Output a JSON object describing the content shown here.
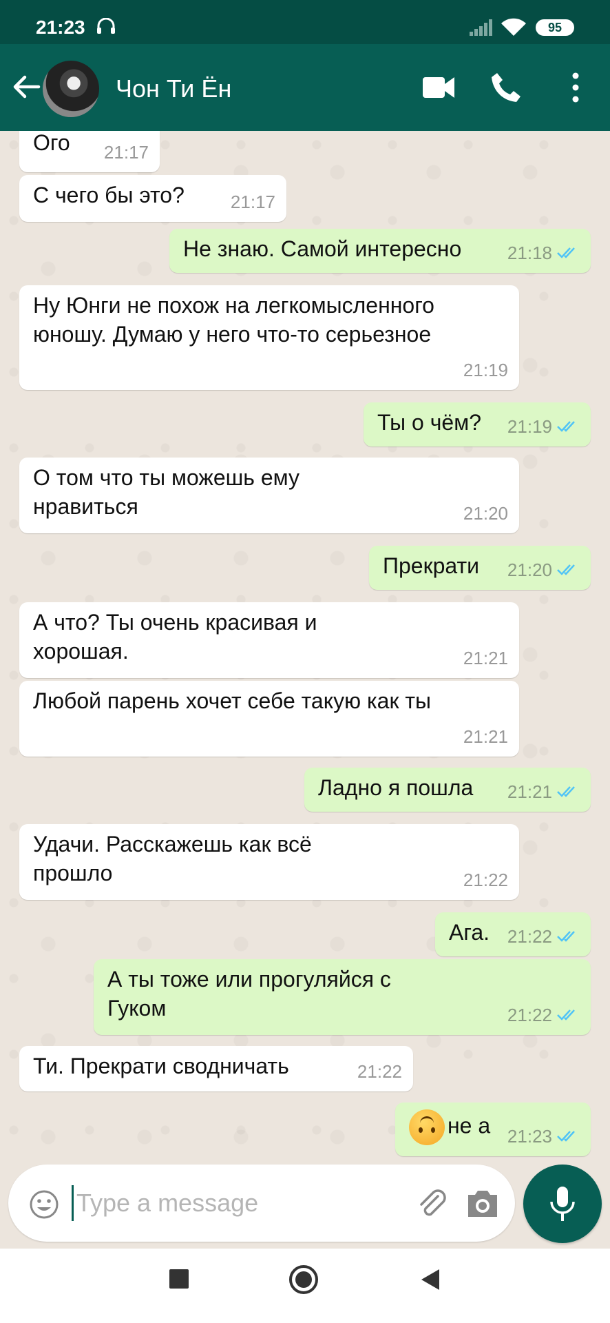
{
  "status_bar": {
    "time": "21:23",
    "battery": "95"
  },
  "header": {
    "contact_name": "Чон Ти Ён"
  },
  "messages": [
    {
      "dir": "in",
      "text": "Ого",
      "time": "21:17"
    },
    {
      "dir": "in",
      "text": "С чего бы это?",
      "time": "21:17"
    },
    {
      "dir": "out",
      "text": "Не знаю. Самой интересно",
      "time": "21:18"
    },
    {
      "dir": "in",
      "text": "Ну Юнги не похож на легкомысленного юношу. Думаю у него что-то серьезное",
      "time": "21:19"
    },
    {
      "dir": "out",
      "text": "Ты о чём?",
      "time": "21:19"
    },
    {
      "dir": "in",
      "text": "О том что ты можешь ему нравиться",
      "time": "21:20"
    },
    {
      "dir": "out",
      "text": "Прекрати",
      "time": "21:20"
    },
    {
      "dir": "in",
      "text": "А что? Ты очень красивая и хорошая.",
      "time": "21:21"
    },
    {
      "dir": "in",
      "text": "Любой парень хочет себе такую как ты",
      "time": "21:21"
    },
    {
      "dir": "out",
      "text": "Ладно я пошла",
      "time": "21:21"
    },
    {
      "dir": "in",
      "text": "Удачи. Расскажешь как всё прошло",
      "time": "21:22"
    },
    {
      "dir": "out",
      "text": "Ага.",
      "time": "21:22"
    },
    {
      "dir": "out",
      "text": "А ты тоже или прогуляйся с Гуком",
      "time": "21:22"
    },
    {
      "dir": "in",
      "text": "Ти. Прекрати сводничать",
      "time": "21:22"
    },
    {
      "dir": "out",
      "text": "не а",
      "time": "21:23",
      "emoji": "upside-down-face"
    }
  ],
  "input": {
    "placeholder": "Type a message"
  },
  "colors": {
    "header": "#075E54",
    "status_bar": "#054D44",
    "outgoing_bubble": "#DCF8C6",
    "incoming_bubble": "#FFFFFF",
    "ticks": "#4FC3F7"
  }
}
